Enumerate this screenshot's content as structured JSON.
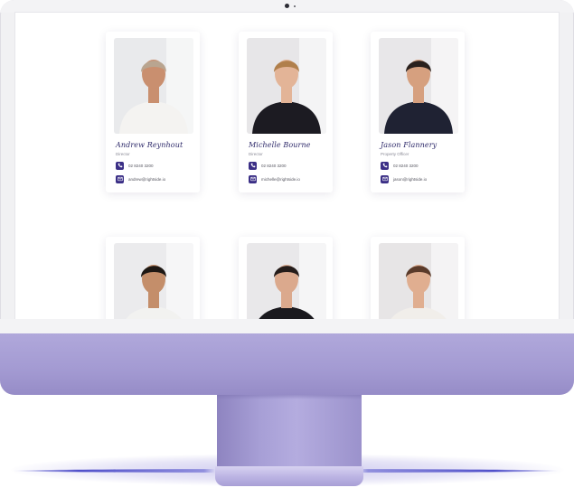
{
  "team": [
    {
      "name": "Andrew Reynhout",
      "role": "Director",
      "phone": "02 8240 3200",
      "email": "andrew@rightside.io",
      "photo_tone": "#c98f6f",
      "photo_bg": "#e9eaec",
      "outfit": "#f4f3f1",
      "hair": "#b9a590"
    },
    {
      "name": "Michelle Bourne",
      "role": "Director",
      "phone": "02 8240 3200",
      "email": "michelle@rightside.io",
      "photo_tone": "#e3b497",
      "photo_bg": "#e7e6e8",
      "outfit": "#1c1b22",
      "hair": "#b07f4b"
    },
    {
      "name": "Jason Flannery",
      "role": "Property Officer",
      "phone": "02 8240 3200",
      "email": "jason@rightside.io",
      "photo_tone": "#d6a07f",
      "photo_bg": "#e8e7e9",
      "outfit": "#1f2233",
      "hair": "#2a211d"
    },
    {
      "name": "",
      "role": "",
      "phone": "",
      "email": "",
      "photo_tone": "#c48e6a",
      "photo_bg": "#ebebed",
      "outfit": "#f2f2f0",
      "hair": "#1e1814"
    },
    {
      "name": "",
      "role": "",
      "phone": "",
      "email": "",
      "photo_tone": "#dba98d",
      "photo_bg": "#e9e8ea",
      "outfit": "#1a191e",
      "hair": "#241c1a"
    },
    {
      "name": "",
      "role": "",
      "phone": "",
      "email": "",
      "photo_tone": "#e0ae90",
      "photo_bg": "#e7e5e6",
      "outfit": "#f1eeea",
      "hair": "#5a3a2a"
    }
  ],
  "colors": {
    "accent": "#3b2f86",
    "name_text": "#2e2a6a",
    "monitor_chin": "#a39ad2"
  },
  "icons": {
    "phone": "phone-icon",
    "email": "email-icon"
  }
}
